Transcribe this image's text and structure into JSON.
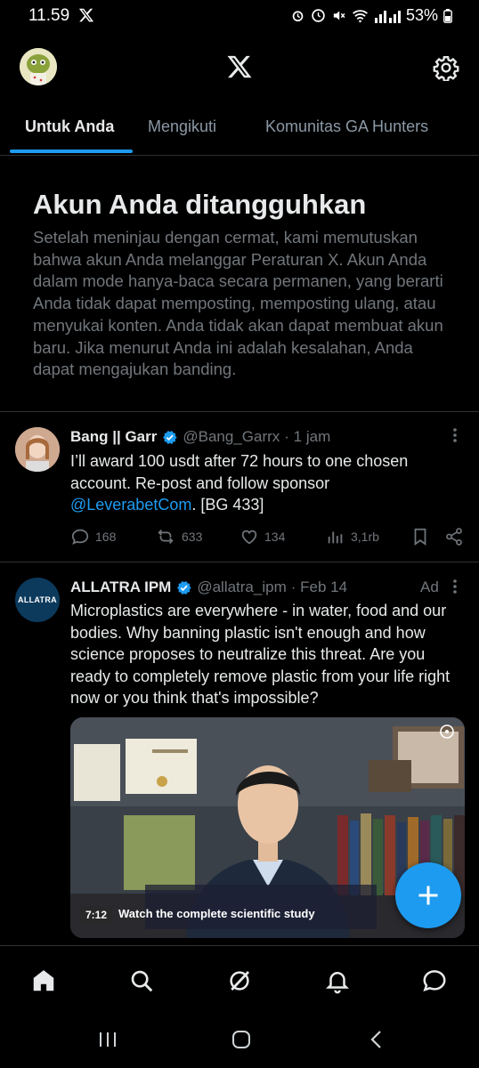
{
  "status_bar": {
    "time": "11.59",
    "battery": "53%"
  },
  "tabs": [
    {
      "label": "Untuk Anda",
      "active": true
    },
    {
      "label": "Mengikuti",
      "active": false
    },
    {
      "label": "Komunitas GA Hunters",
      "active": false
    }
  ],
  "suspended": {
    "title": "Akun Anda ditangguhkan",
    "body": "Setelah meninjau dengan cermat, kami memutuskan bahwa akun Anda melanggar Peraturan X. Akun Anda dalam mode hanya-baca secara permanen, yang berarti Anda tidak dapat memposting, memposting ulang, atau menyukai konten. Anda tidak akan dapat membuat akun baru. Jika menurut Anda ini adalah kesalahan, Anda dapat mengajukan banding."
  },
  "tweet1": {
    "name": "Bang || Garr",
    "handle": "@Bang_Garrx",
    "time": "· 1 jam",
    "text_before": "I’ll award 100 usdt after 72 hours to one chosen account. Re-post and follow sponsor ",
    "link": "@LeverabetCom",
    "text_after": ". [BG 433]",
    "replies": "168",
    "reposts": "633",
    "likes": "134",
    "views": "3,1rb"
  },
  "tweet2": {
    "name": "ALLATRA IPM",
    "handle": "@allatra_ipm",
    "time": "· Feb 14",
    "ad_label": "Ad",
    "avatar_text": "ALLATRA",
    "text": "Microplastics are everywhere - in water, food and our bodies. Why banning plastic isn't enough and how science proposes to neutralize this threat. Are you ready to completely remove plastic from your life right now or you think that's impossible?",
    "video_duration": "7:12",
    "video_caption": "Watch the complete scientific study"
  },
  "colors": {
    "accent": "#1d9bf0",
    "background": "#000000",
    "secondary_text": "#71767b"
  }
}
